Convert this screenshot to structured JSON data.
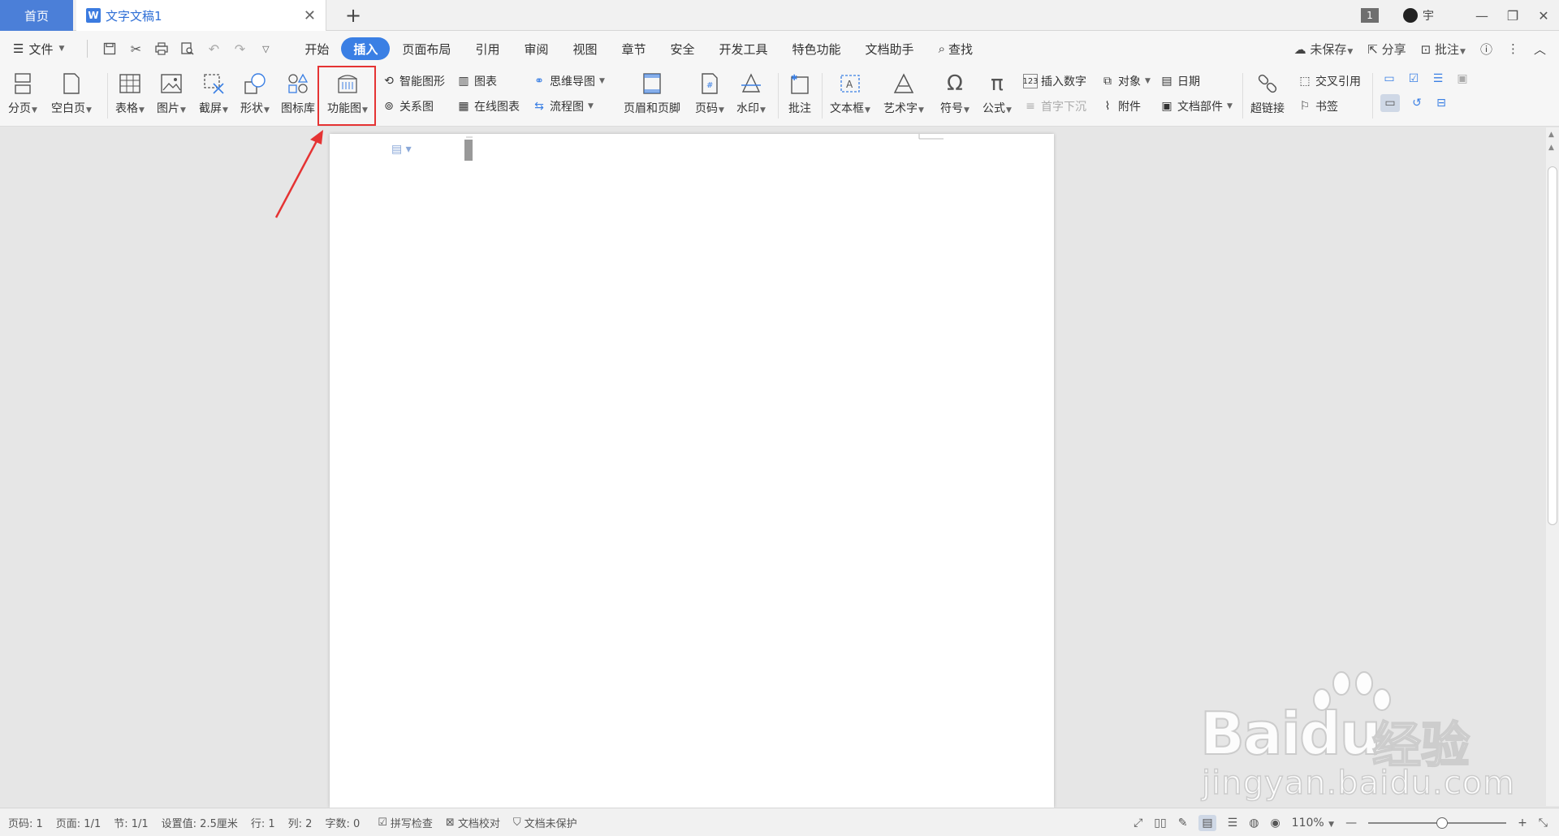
{
  "tabs": {
    "home": "首页",
    "doc": "文字文稿1",
    "doc_icon": "W",
    "new_tab": "+"
  },
  "title_right": {
    "badge": "1",
    "user": "宇"
  },
  "menu": {
    "file": "文件",
    "tabs": [
      "开始",
      "插入",
      "页面布局",
      "引用",
      "审阅",
      "视图",
      "章节",
      "安全",
      "开发工具",
      "特色功能",
      "文档助手",
      "查找"
    ],
    "active_tab": "插入",
    "right": {
      "unsaved": "未保存",
      "share": "分享",
      "comment": "批注"
    }
  },
  "ribbon": {
    "page_break": "分页",
    "blank_page": "空白页",
    "table": "表格",
    "picture": "图片",
    "screenshot": "截屏",
    "shape": "形状",
    "icon_lib": "图标库",
    "function_chart": "功能图",
    "smart_shape": "智能图形",
    "chart": "图表",
    "mind_map": "思维导图",
    "relation_chart": "关系图",
    "online_chart": "在线图表",
    "flow_chart": "流程图",
    "header_footer": "页眉和页脚",
    "page_number": "页码",
    "watermark": "水印",
    "comment": "批注",
    "textbox": "文本框",
    "wordart": "艺术字",
    "symbol": "符号",
    "formula": "公式",
    "insert_number": "插入数字",
    "dropcap": "首字下沉",
    "object": "对象",
    "attachment": "附件",
    "date": "日期",
    "doc_parts": "文档部件",
    "hyperlink": "超链接",
    "cross_ref": "交叉引用",
    "bookmark": "书签"
  },
  "status": {
    "page": "页码: 1",
    "pages": "页面: 1/1",
    "section": "节: 1/1",
    "setting": "设置值: 2.5厘米",
    "row": "行: 1",
    "col": "列: 2",
    "words": "字数: 0",
    "spell": "拼写检查",
    "proof": "文档校对",
    "protect": "文档未保护",
    "zoom": "110%"
  },
  "watermark": {
    "brand": "Bai",
    "brand2": "du",
    "cn": "经验",
    "url": "jingyan.baidu.com"
  },
  "colors": {
    "accent": "#3a7fe4",
    "highlight": "#e53333",
    "home_tab": "#4b7fd8"
  }
}
